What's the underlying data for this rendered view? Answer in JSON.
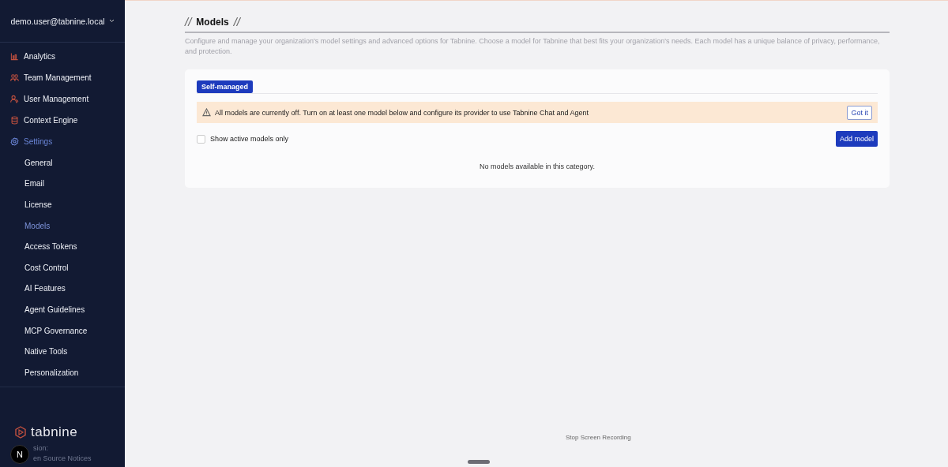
{
  "sidebar": {
    "account": "demo.user@tabnine.local",
    "items": [
      {
        "label": "Analytics",
        "selected": false
      },
      {
        "label": "Team Management",
        "selected": false
      },
      {
        "label": "User Management",
        "selected": false
      },
      {
        "label": "Context Engine",
        "selected": false
      },
      {
        "label": "Settings",
        "selected": true,
        "children": [
          {
            "label": "General",
            "selected": false
          },
          {
            "label": "Email",
            "selected": false
          },
          {
            "label": "License",
            "selected": false
          },
          {
            "label": "Models",
            "selected": true
          },
          {
            "label": "Access Tokens",
            "selected": false
          },
          {
            "label": "Cost Control",
            "selected": false
          },
          {
            "label": "AI Features",
            "selected": false
          },
          {
            "label": "Agent Guidelines",
            "selected": false
          },
          {
            "label": "MCP Governance",
            "selected": false
          },
          {
            "label": "Native Tools",
            "selected": false
          },
          {
            "label": "Personalization",
            "selected": false
          }
        ]
      }
    ],
    "logo": "tabnine",
    "badge": "N",
    "version": "sion:",
    "notices": "en Source Notices"
  },
  "page": {
    "title_prefix": "//",
    "title": "Models",
    "title_suffix": "//",
    "description": "Configure and manage your organization's model settings and advanced options for Tabnine. Choose a model for Tabnine that best fits your organization's needs. Each model has a unique balance of privacy, performance, and protection.",
    "tabs": [
      {
        "label": "Self-managed",
        "selected": true
      }
    ],
    "alert": {
      "text": "All models are currently off. Turn on at least one model below and configure its provider to use Tabnine Chat and Agent",
      "button": "Got it"
    },
    "filter": {
      "label": "Show active models only",
      "checked": false
    },
    "add_button": "Add model",
    "empty": "No models available in this category."
  },
  "overlay": {
    "stop_recording": "Stop Screen Recording"
  }
}
